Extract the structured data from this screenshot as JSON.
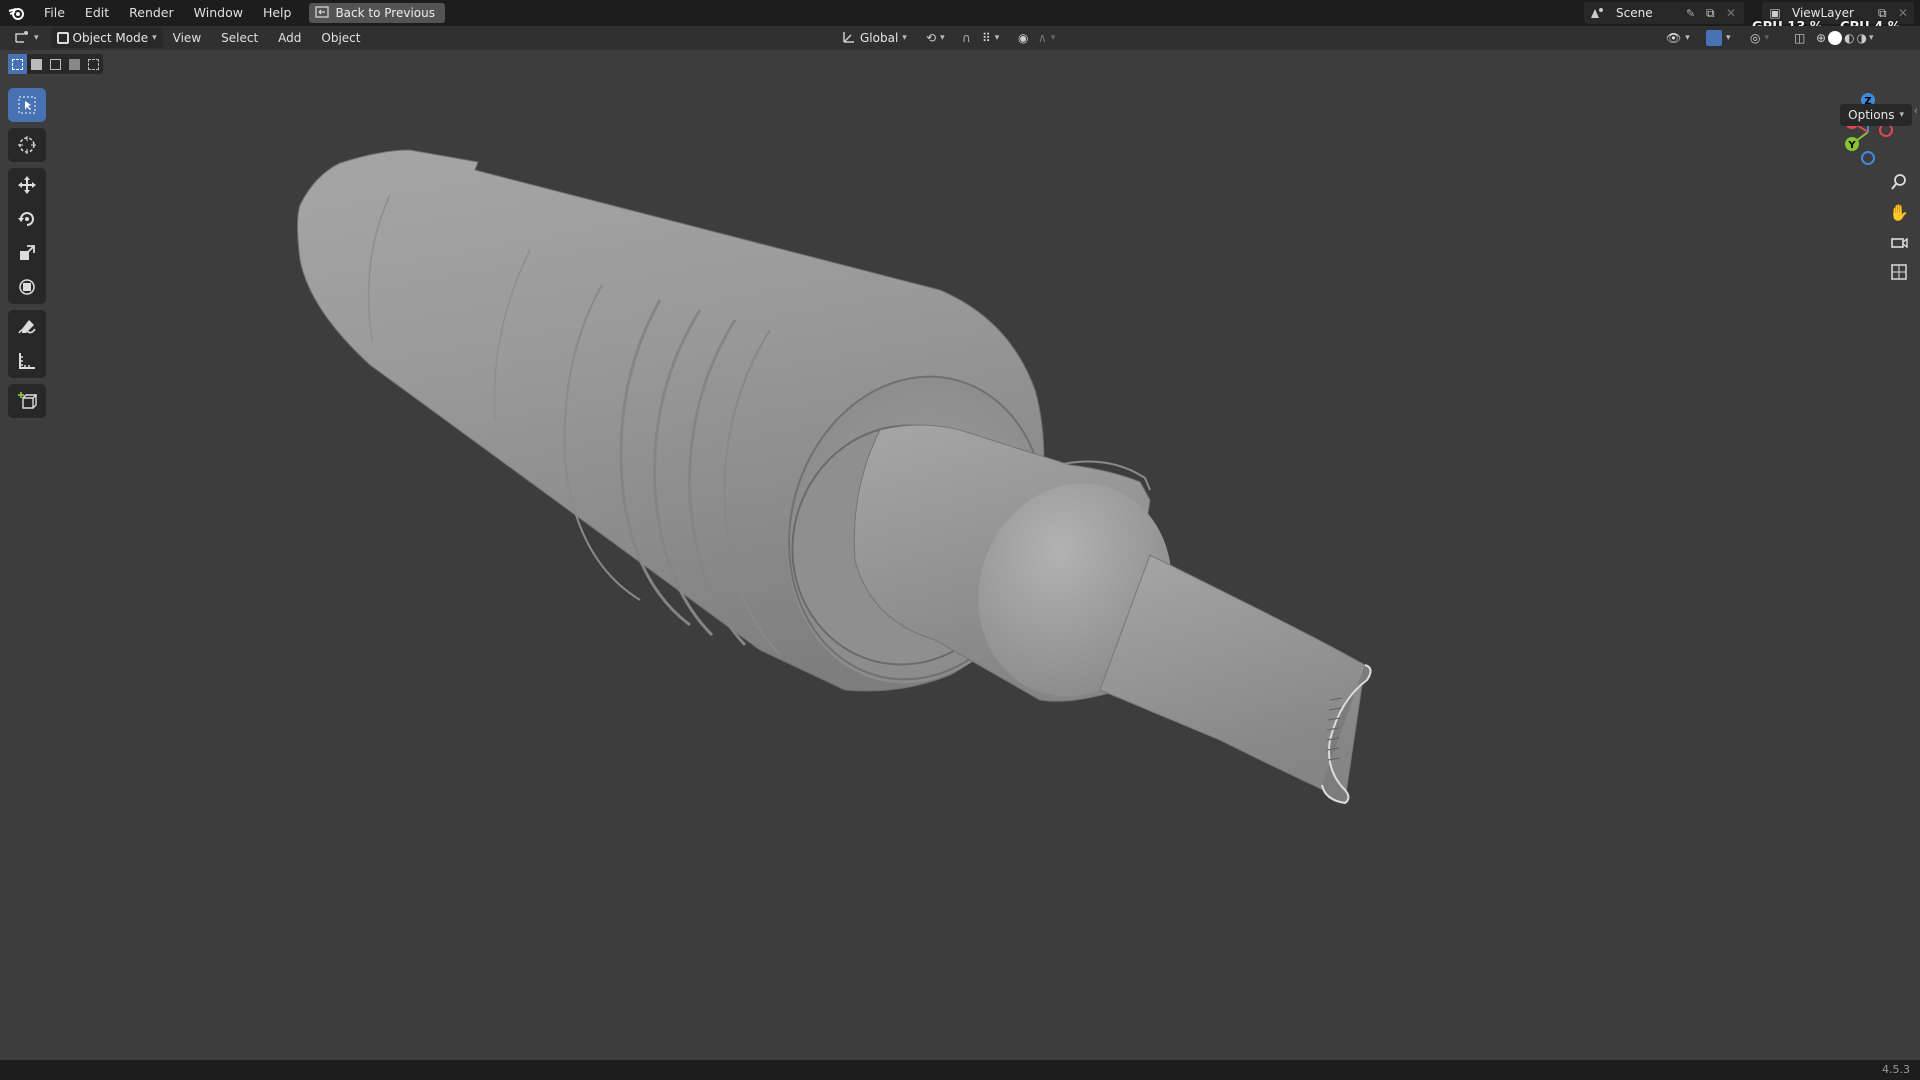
{
  "menu": {
    "items": [
      "File",
      "Edit",
      "Render",
      "Window",
      "Help"
    ],
    "back_label": "Back to Previous"
  },
  "scene": {
    "name": "Scene",
    "view_layer": "ViewLayer"
  },
  "perf": {
    "gpu_label": "GPU",
    "gpu_value": "13 %",
    "cpu_label": "CPU",
    "cpu_value": "4 %"
  },
  "header": {
    "mode": "Object Mode",
    "menus": [
      "View",
      "Select",
      "Add",
      "Object"
    ],
    "orientation": "Global"
  },
  "viewport": {
    "options_label": "Options",
    "gizmo_axes": [
      "Z",
      "X",
      "Y"
    ],
    "object": "muffler-mesh"
  },
  "toolbar": {
    "tools": [
      "select-box",
      "cursor",
      "move",
      "rotate",
      "scale",
      "transform",
      "annotate",
      "measure",
      "add-cube"
    ],
    "active": "select-box"
  },
  "status": {
    "version": "4.5.3"
  },
  "colors": {
    "accent": "#4772b3",
    "background": "#3d3d3d",
    "header": "#303030",
    "topbar": "#1d1d1d",
    "axis_x": "#e0465a",
    "axis_y": "#8ac331",
    "axis_z": "#3d8ae0"
  }
}
